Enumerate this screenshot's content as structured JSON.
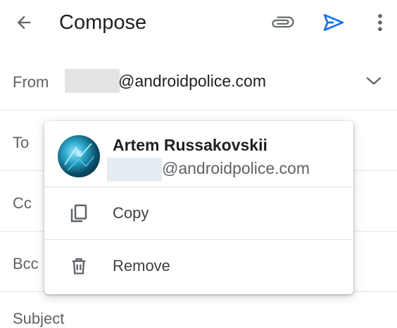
{
  "topbar": {
    "title": "Compose",
    "icons": {
      "back": "back-arrow-icon",
      "attach": "paperclip-icon",
      "send": "send-icon",
      "more": "more-vert-icon"
    },
    "send_color": "#1a73e8"
  },
  "from": {
    "label": "From",
    "email_domain": "@androidpolice.com"
  },
  "fields": {
    "to_label": "To",
    "cc_label": "Cc",
    "bcc_label": "Bcc",
    "subject_label": "Subject"
  },
  "contact_popup": {
    "name": "Artem Russakovskii",
    "email_domain": "@androidpolice.com",
    "menu": [
      {
        "label": "Copy",
        "icon": "copy-icon"
      },
      {
        "label": "Remove",
        "icon": "trash-icon"
      }
    ]
  }
}
